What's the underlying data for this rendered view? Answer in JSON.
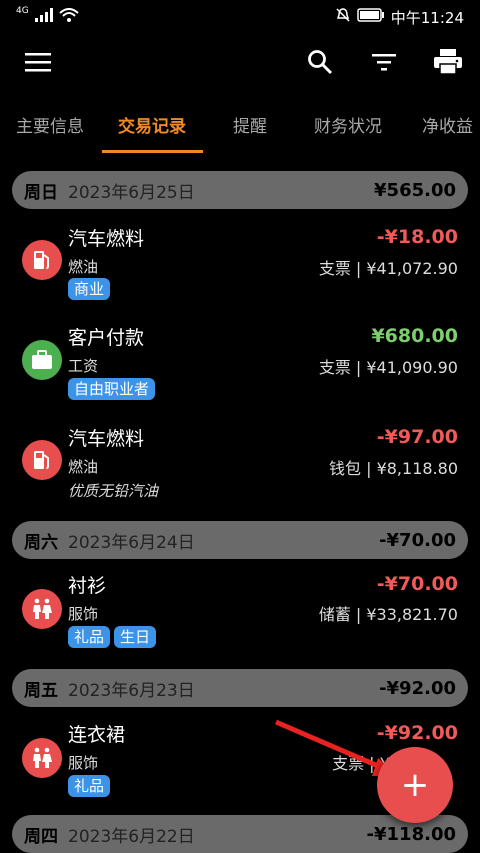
{
  "status": {
    "signal_label": "4G",
    "time": "中午11:24",
    "icons": [
      "signal-icon",
      "wifi-icon",
      "mute-icon",
      "battery-icon"
    ]
  },
  "toolbar": {
    "icons": [
      "menu-icon",
      "search-icon",
      "filter-icon",
      "print-icon"
    ]
  },
  "tabs": [
    {
      "label": "主要信息",
      "active": false
    },
    {
      "label": "交易记录",
      "active": true
    },
    {
      "label": "提醒",
      "active": false
    },
    {
      "label": "财务状况",
      "active": false
    },
    {
      "label": "净收益",
      "active": false
    }
  ],
  "colors": {
    "accent": "#f08a24",
    "expense": "#f25a5a",
    "income": "#7dcf6e",
    "tag": "#3c94e8",
    "fab": "#e94e4e",
    "fuel_icon_bg": "#e94e4e",
    "salary_icon_bg": "#4caf50"
  },
  "days": [
    {
      "weekday": "周日",
      "date": "2023年6月25日",
      "total": "¥565.00",
      "transactions": [
        {
          "title": "汽车燃料",
          "category": "燃油",
          "tags": [
            "商业"
          ],
          "note": "",
          "amount": "-¥18.00",
          "type": "expense",
          "account": "支票 | ¥41,072.90",
          "icon": "fuel-pump-icon"
        },
        {
          "title": "客户付款",
          "category": "工资",
          "tags": [
            "自由职业者"
          ],
          "note": "",
          "amount": "¥680.00",
          "type": "income",
          "account": "支票 | ¥41,090.90",
          "icon": "briefcase-icon"
        },
        {
          "title": "汽车燃料",
          "category": "燃油",
          "tags": [],
          "note": "优质无铅汽油",
          "amount": "-¥97.00",
          "type": "expense",
          "account": "钱包 | ¥8,118.80",
          "icon": "fuel-pump-icon"
        }
      ]
    },
    {
      "weekday": "周六",
      "date": "2023年6月24日",
      "total": "-¥70.00",
      "transactions": [
        {
          "title": "衬衫",
          "category": "服饰",
          "tags": [
            "礼品",
            "生日"
          ],
          "note": "",
          "amount": "-¥70.00",
          "type": "expense",
          "account": "储蓄 | ¥33,821.70",
          "icon": "clothing-icon"
        }
      ]
    },
    {
      "weekday": "周五",
      "date": "2023年6月23日",
      "total": "-¥92.00",
      "transactions": [
        {
          "title": "连衣裙",
          "category": "服饰",
          "tags": [
            "礼品"
          ],
          "note": "",
          "amount": "-¥92.00",
          "type": "expense",
          "account": "支票 | ¥4",
          "icon": "clothing-icon"
        }
      ]
    },
    {
      "weekday": "周四",
      "date": "2023年6月22日",
      "total": "-¥118.00",
      "transactions": []
    }
  ],
  "fab": {
    "label": "+",
    "icon": "plus-icon"
  }
}
